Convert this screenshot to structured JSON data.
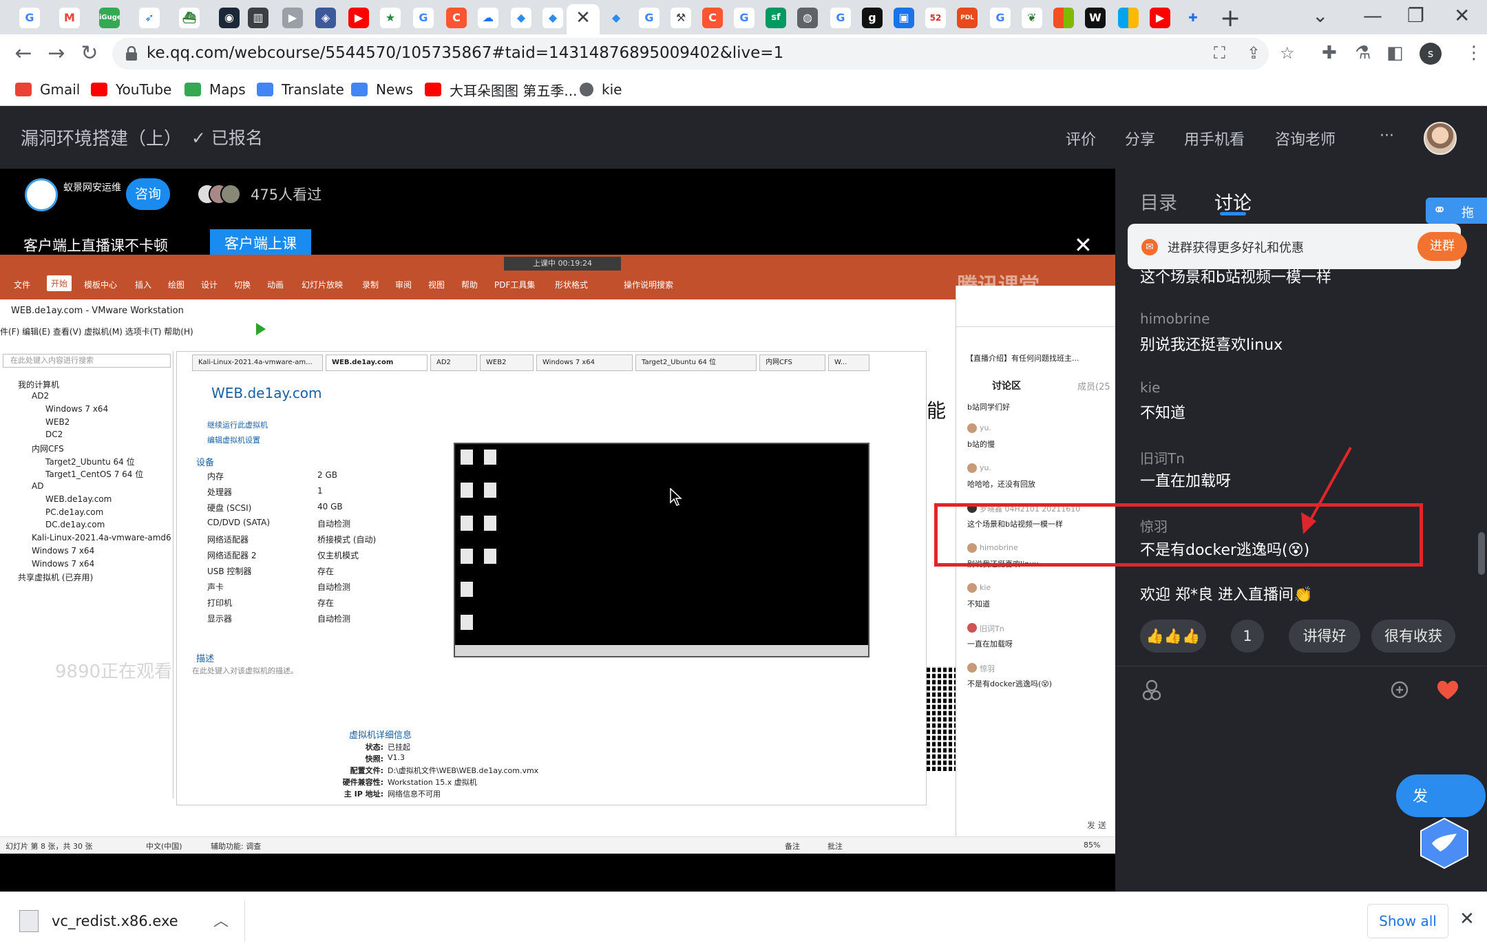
{
  "browser": {
    "address": "ke.qq.com/webcourse/5544570/105735867#taid=14314876895009402&live=1",
    "new_tab": "+",
    "tab_close": "✕",
    "profile_initial": "s",
    "bookmarks": [
      {
        "label": "Gmail",
        "color": "#ea4335"
      },
      {
        "label": "YouTube",
        "color": "#ff0000"
      },
      {
        "label": "Maps",
        "color": "#34a853"
      },
      {
        "label": "Translate",
        "color": "#4285f4"
      },
      {
        "label": "News",
        "color": "#4285f4"
      },
      {
        "label": "大耳朵图图 第五季...",
        "color": "#ff0000"
      },
      {
        "label": "kie",
        "color": "#5f6368"
      }
    ]
  },
  "header": {
    "course_title": "漏洞环境搭建（上）",
    "enrolled": "✓ 已报名",
    "links": [
      "评价",
      "分享",
      "用手机看",
      "咨询老师",
      "···"
    ]
  },
  "player": {
    "org_name": "蚁景网安运维",
    "consult": "咨询",
    "viewers": "475人看过",
    "client_tip": "客户端上直播课不卡顿",
    "client_button": "客户端上课",
    "close": "✕"
  },
  "video": {
    "live_timer": "上课中 00:19:24",
    "tencent_watermark": "腾讯课堂",
    "ribbon": [
      "文件",
      "开始",
      "模板中心",
      "插入",
      "绘图",
      "设计",
      "切换",
      "动画",
      "幻灯片放映",
      "录制",
      "审阅",
      "视图",
      "帮助",
      "PDF工具集",
      "形状格式",
      "操作说明搜索"
    ],
    "vm_title": "WEB.de1ay.com - VMware Workstation",
    "vm_menus": "件(F)   编辑(E)   查看(V)   虚拟机(M)   选项卡(T)   帮助(H)",
    "vm_search": "在此处键入内容进行搜索",
    "tree": [
      "我的计算机",
      "AD2",
      "Windows 7 x64",
      "WEB2",
      "DC2",
      "内网CFS",
      "Target2_Ubuntu 64 位",
      "Target1_CentOS 7 64 位",
      "AD",
      "WEB.de1ay.com",
      "PC.de1ay.com",
      "DC.de1ay.com",
      "Kali-Linux-2021.4a-vmware-amd6",
      "Windows 7 x64",
      "Windows 7 x64",
      "共享虚拟机 (已弃用)"
    ],
    "vm_tabs": [
      "Kali-Linux-2021.4a-vmware-am...",
      "WEB.de1ay.com",
      "AD2",
      "WEB2",
      "Windows 7 x64",
      "Target2_Ubuntu 64 位",
      "内网CFS",
      "W..."
    ],
    "vm_name": "WEB.de1ay.com",
    "actions": [
      "继续运行此虚拟机",
      "编辑虚拟机设置"
    ],
    "devices_title": "设备",
    "devices": [
      {
        "k": "内存",
        "v": "2 GB"
      },
      {
        "k": "处理器",
        "v": "1"
      },
      {
        "k": "硬盘 (SCSI)",
        "v": "40 GB"
      },
      {
        "k": "CD/DVD (SATA)",
        "v": "自动检测"
      },
      {
        "k": "网络适配器",
        "v": "桥接模式 (自动)"
      },
      {
        "k": "网络适配器 2",
        "v": "仅主机模式"
      },
      {
        "k": "USB 控制器",
        "v": "存在"
      },
      {
        "k": "声卡",
        "v": "自动检测"
      },
      {
        "k": "打印机",
        "v": "存在"
      },
      {
        "k": "显示器",
        "v": "自动检测"
      }
    ],
    "desc_title": "描述",
    "desc": "在此处键入对该虚拟机的描述。",
    "details_title": "虚拟机详细信息",
    "details": [
      {
        "k": "状态:",
        "v": "已挂起"
      },
      {
        "k": "快照:",
        "v": "V1.3"
      },
      {
        "k": "配置文件:",
        "v": "D:\\虚拟机文件\\WEB\\WEB.de1ay.com.vmx"
      },
      {
        "k": "硬件兼容性:",
        "v": "Workstation 15.x 虚拟机"
      },
      {
        "k": "主 IP 地址:",
        "v": "网络信息不可用"
      }
    ],
    "watermark": "9890正在观看",
    "caption_text": "能",
    "chat": {
      "intro": "【直播介绍】有任何问题找班主...",
      "tab": "讨论区",
      "members": "成员(25",
      "send": "发 送",
      "messages": [
        {
          "name": "",
          "text": "b站同学们好"
        },
        {
          "name": "yu.",
          "text": "b站的慢"
        },
        {
          "name": "yu.",
          "text": "哈哈哈，还没有回放"
        },
        {
          "name": "罗晓鑫 04H2101 20211610",
          "text": "这个场景和b站视频一模一样"
        },
        {
          "name": "himobrine",
          "text": "别说我还挺喜欢linux"
        },
        {
          "name": "kie",
          "text": "不知道"
        },
        {
          "name": "旧词Tn",
          "text": "一直在加载呀"
        },
        {
          "name": "惊羽",
          "text": "不是有docker逃逸吗(😵)"
        }
      ]
    },
    "status": [
      "幻灯片 第 8 张，共 30 张",
      "中文(中国)",
      "辅助功能: 调查",
      "备注",
      "批注",
      "85%"
    ]
  },
  "side": {
    "tabs": [
      "目录",
      "讨论"
    ],
    "group_banner": "进群获得更多好礼和优惠",
    "group_button": "进群",
    "float_label": "拖",
    "messages": [
      {
        "name": "",
        "text": "这个场景和b站视频一模一样"
      },
      {
        "name": "himobrine",
        "text": "别说我还挺喜欢linux"
      },
      {
        "name": "kie",
        "text": "不知道"
      },
      {
        "name": "旧词Tn",
        "text": "一直在加载呀"
      },
      {
        "name": "惊羽",
        "text": "不是有docker逃逸吗(😵)"
      },
      {
        "name": "",
        "text": "欢迎 郑*良 进入直播间👏"
      }
    ],
    "quick_replies": [
      "👍👍👍",
      "1",
      "讲得好",
      "很有收获"
    ],
    "share_label": "发"
  },
  "download": {
    "file": "vc_redist.x86.exe",
    "show_all": "Show all",
    "close": "✕"
  },
  "colors": {
    "accent": "#2b8cf0",
    "annotation": "#e0262a",
    "ppt_ribbon": "#c3502c",
    "header_bg": "#23252b"
  }
}
